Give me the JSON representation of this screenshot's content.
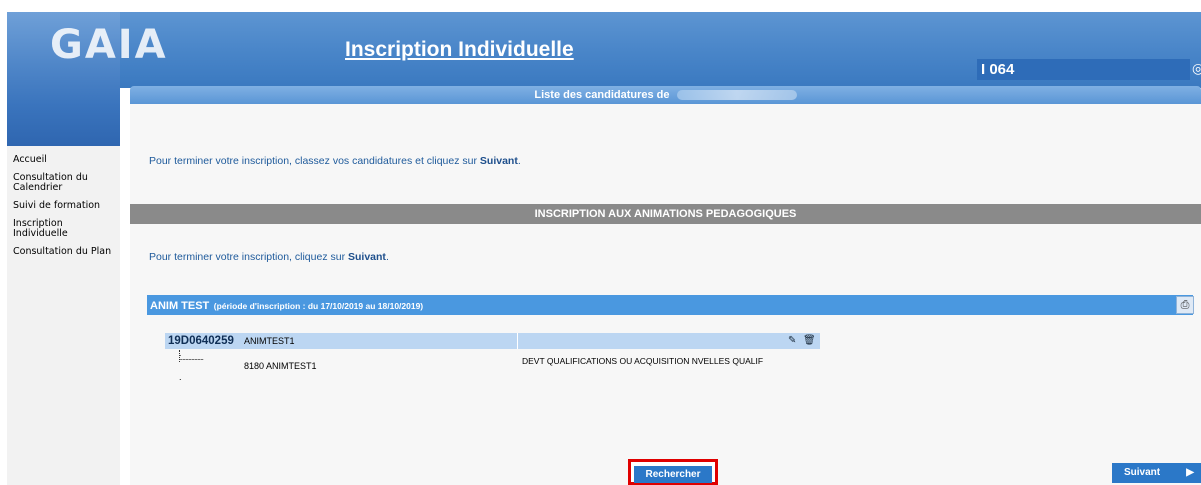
{
  "header": {
    "logo_text": "GAIA",
    "app_title": "Inscription Individuelle",
    "code": "I 064"
  },
  "sidebar": {
    "items": [
      {
        "label": "Accueil"
      },
      {
        "label": "Consultation du Calendrier"
      },
      {
        "label": "Suivi de formation"
      },
      {
        "label": "Inscription Individuelle"
      },
      {
        "label": "Consultation du Plan"
      }
    ]
  },
  "candidatures": {
    "title": "Liste des candidatures de",
    "intro_text": "Pour terminer votre inscription, classez vos candidatures et cliquez sur",
    "intro_emph": "Suivant",
    "intro_end": "."
  },
  "section": {
    "title": "INSCRIPTION AUX ANIMATIONS PEDAGOGIQUES",
    "text": "Pour terminer votre inscription, cliquez sur",
    "text_emph": "Suivant",
    "text_end": "."
  },
  "animation": {
    "name": "ANIM TEST",
    "period": "(période d'inscription : du 17/10/2019 au 18/10/2019)",
    "row_code": "19D0640259",
    "row_label": "ANIMTEST1",
    "sub_item": "8180 ANIMTEST1",
    "category": "DEVT QUALIFICATIONS OU ACQUISITION NVELLES QUALIF"
  },
  "buttons": {
    "rechercher": "Rechercher",
    "suivant": "Suivant"
  },
  "colors": {
    "header_blue": "#4a86c9",
    "bar_blue": "#4a98e0",
    "button_blue": "#2b78c8",
    "gray_band": "#8a8a8a",
    "highlight_red": "#e00000"
  }
}
